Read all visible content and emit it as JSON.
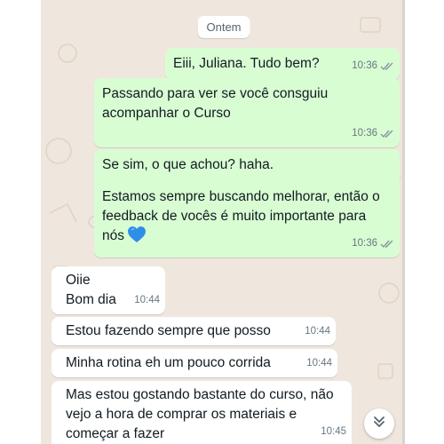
{
  "date_divider": "Ontem",
  "messages": [
    {
      "direction": "outgoing",
      "text": "Eiii, Juliana. Tudo bem?",
      "time": "10:36",
      "status": "read"
    },
    {
      "direction": "outgoing",
      "text": "Passando para ver se você consguiu acompanhar o Curso",
      "time": "10:36",
      "status": "read"
    },
    {
      "direction": "outgoing",
      "text_line1": "Se sim, o que achou? haha.",
      "text_line2": "Estamos sempre buscando melhorar, então o feedback de vocês é muito importante para nós",
      "emoji": "blue-heart",
      "time": "10:36",
      "status": "read"
    },
    {
      "direction": "incoming",
      "text": "Oiie\nBom dia",
      "time": "10:44"
    },
    {
      "direction": "incoming",
      "text": "Estou fazendo sempre que posso",
      "time": "10:44"
    },
    {
      "direction": "incoming",
      "text": "Minha rotina eh um pouco corrida",
      "time": "10:44"
    },
    {
      "direction": "incoming",
      "text": "Mas estou gostando bastante do curso, não vejo a hora de comprar os materiais e começar a fazer",
      "time": "10:45"
    }
  ],
  "icons": {
    "read_receipt": "double-check-icon",
    "scroll_down": "chevrons-down-icon",
    "heart": "blue-heart-emoji"
  },
  "colors": {
    "outgoing_bubble": "#d9fdd3",
    "incoming_bubble": "#ffffff",
    "chat_background": "#efe7de",
    "heart": "#2f8fe8"
  }
}
